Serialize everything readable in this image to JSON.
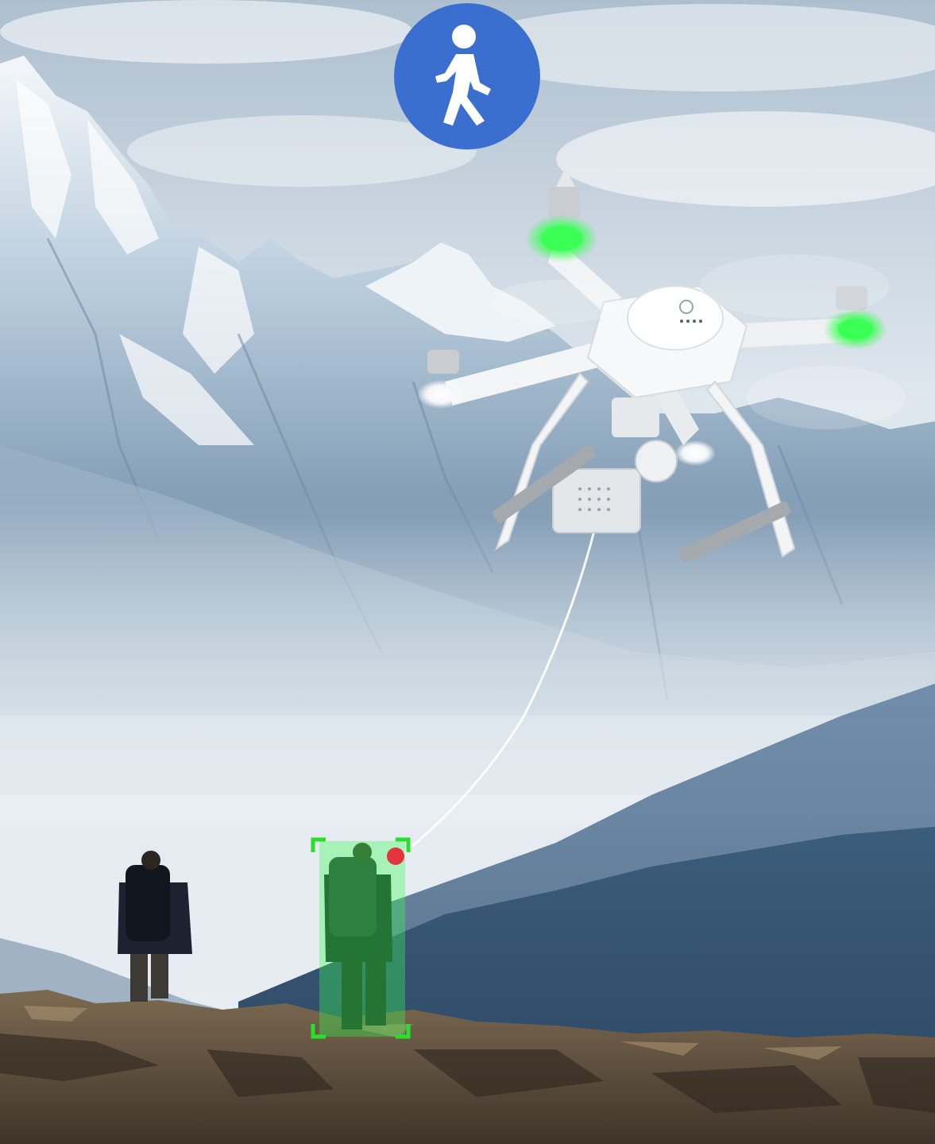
{
  "scene": {
    "mode": "follow-me",
    "badge_icon": "walking-person-icon",
    "badge_color": "#3a6fd0",
    "tracking_box_color": "#28e02a",
    "tracking_dot_color": "#e2363c",
    "drone_led_color": "#3cff55"
  }
}
